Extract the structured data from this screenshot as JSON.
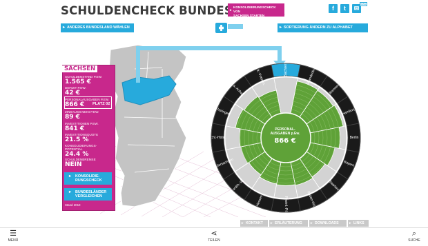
{
  "header": {
    "title": "SCHULDENCHECK BUNDESLÄNDER",
    "cta_line1": "KONSOLIDIERUNGSCHECK VON",
    "cta_line2": "SACHSEN STARTEN",
    "share": {
      "facebook": "f",
      "twitter": "t",
      "email": "✉",
      "mini": "MAIL"
    }
  },
  "nav": {
    "left_label": "ANDERES BUNDESLAND WÄHLEN",
    "right_label": "SORTIERUNG ÄNDERN ZU ALPHABET"
  },
  "panel": {
    "state": "SACHSEN",
    "stats": [
      {
        "label": "SCHULDENSTAND p.Ew.",
        "value": "1.565 €"
      },
      {
        "label": "DEFIZIT p.Ew.",
        "value": "42 €"
      },
      {
        "label": "PERSONALAUSGABEN p.Ew.",
        "value": "866 €",
        "rank": "PLATZ 02"
      },
      {
        "label": "ZINSAUSGABEN p.Ew.",
        "value": "89 €"
      },
      {
        "label": "INVESTITIONEN p.Ew.",
        "value": "841 €"
      },
      {
        "label": "INVESTITIONSQUOTE",
        "value": "21.5 %"
      },
      {
        "label": "KONSOLIDIERUNGS-\nPOTENTIAL",
        "value": "24.4 %"
      },
      {
        "label": "SCHULDENBREMSE",
        "value": "NEIN"
      }
    ],
    "btn_consolidation": "KONSOLIDIE-\nRUNGSCHECK",
    "btn_compare": "BUNDESLÄNDER\nVERGLEICHEN",
    "stand": "Stand 2010"
  },
  "ring": {
    "center_label_1": "PERSONAL-",
    "center_label_2": "AUSGABEN p.Ew.",
    "center_value": "866 €",
    "states": [
      "Sachsen",
      "Brandenburg",
      "Bremen",
      "Hamburg",
      "Berlin",
      "Bayern",
      "Saarland",
      "Baden-Württ.",
      "Rheinl.-Pfalz",
      "Hessen",
      "Nordrh.-W.",
      "Niedersachsen",
      "Schl.-Holst.",
      "Thüringen",
      "Sa.-Anhalt",
      "Meck.-Vorpom."
    ],
    "colors": {
      "active": "#27aadc",
      "fill": "#5fa238",
      "track": "#d3d3d3",
      "outer": "#1a1a1a"
    }
  },
  "footer_links": [
    "KONTAKT",
    "ERLÄUTERUNG",
    "DOWNLOADS",
    "LINKS"
  ],
  "toolbar": {
    "menu": "MENÜ",
    "share": "TEILEN",
    "search": "SUCHE"
  }
}
